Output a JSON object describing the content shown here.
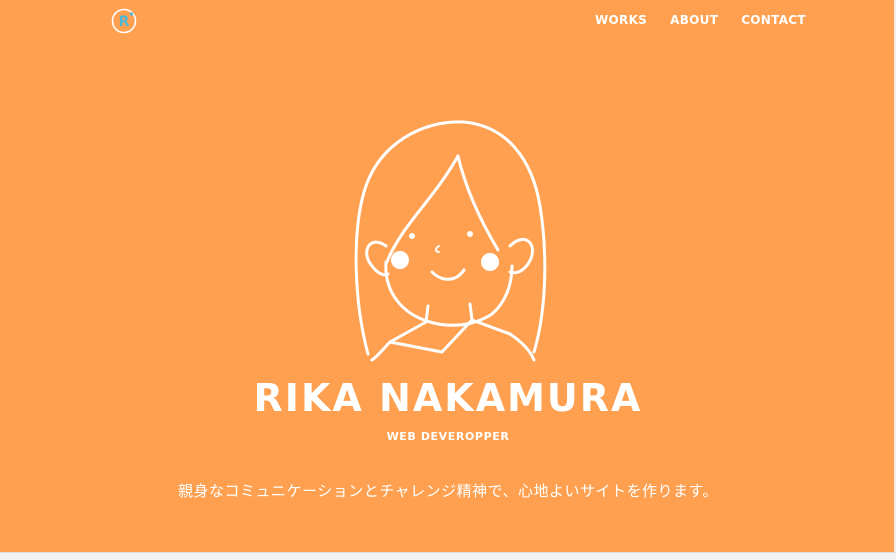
{
  "brand": {
    "logo_letter": "R",
    "accent_color": "#ffa050",
    "logo_color": "#4db8d6",
    "icon": "logo-r-icon"
  },
  "nav": {
    "items": [
      {
        "label": "WORKS"
      },
      {
        "label": "ABOUT"
      },
      {
        "label": "CONTACT"
      }
    ]
  },
  "hero": {
    "illustration_icon": "woman-portrait-illustration",
    "name": "RIKA NAKAMURA",
    "role": "WEB DEVEROPPER",
    "tagline": "親身なコミュニケーションとチャレンジ精神で、心地よいサイトを作ります。"
  }
}
